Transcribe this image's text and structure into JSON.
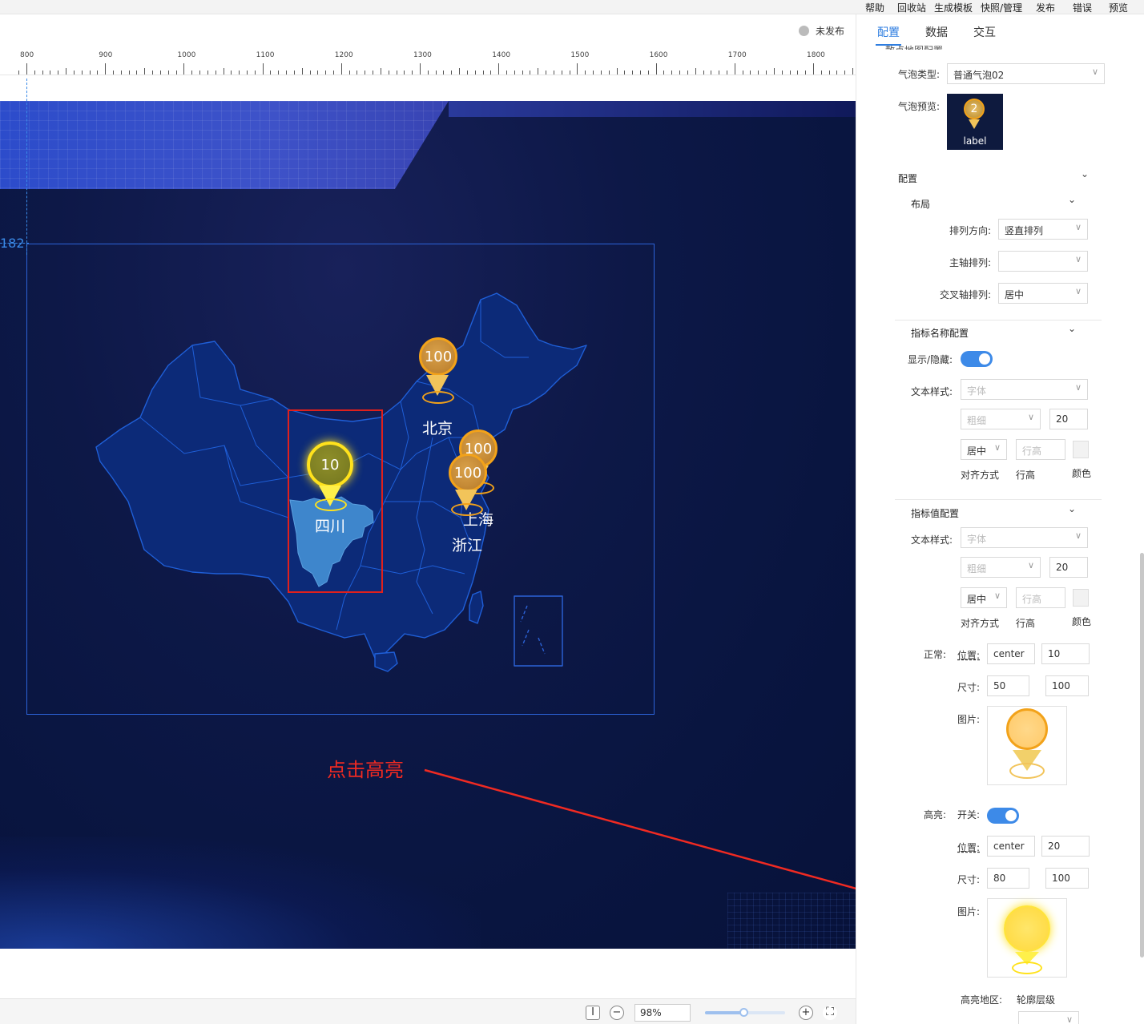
{
  "menu": [
    "帮助",
    "回收站",
    "生成模板",
    "快照/管理",
    "发布",
    "错误",
    "预览"
  ],
  "status": {
    "label": "未发布"
  },
  "ruler": {
    "labels": [
      "800",
      "900",
      "1000",
      "1100",
      "1200",
      "1300",
      "1400",
      "1500",
      "1600",
      "1700",
      "1800"
    ]
  },
  "guide": {
    "value": "182"
  },
  "map": {
    "markers": [
      {
        "value": "100",
        "city": "北京",
        "highlighted": false
      },
      {
        "value": "10",
        "city": "四川",
        "highlighted": true
      },
      {
        "value": "100",
        "city": "上海",
        "highlighted": false
      },
      {
        "value": "100",
        "city": "浙江",
        "highlighted": false
      }
    ],
    "region_fill": "#3e86cc",
    "region_border": "#1f5fd8"
  },
  "annotation": {
    "text": "点击高亮",
    "color": "#f02a22"
  },
  "zoom": {
    "value": "98%",
    "level": 0.48
  },
  "panel": {
    "tabs": [
      "配置",
      "数据",
      "交互"
    ],
    "clipped_header": "散点地图配置",
    "bubble_type": {
      "label": "气泡类型:",
      "value": "普通气泡02"
    },
    "bubble_preview": {
      "label": "气泡预览:",
      "number": "2",
      "caption": "label"
    },
    "config": {
      "title": "配置"
    },
    "layout": {
      "title": "布局",
      "direction": {
        "label": "排列方向:",
        "value": "竖直排列"
      },
      "main_axis": {
        "label": "主轴排列:",
        "value": ""
      },
      "cross_axis": {
        "label": "交叉轴排列:",
        "value": "居中"
      }
    },
    "name_config": {
      "title": "指标名称配置",
      "visible": {
        "label": "显示/隐藏:"
      },
      "text_style": {
        "label": "文本样式:",
        "font_placeholder": "字体",
        "weight_placeholder": "粗细",
        "size": "20",
        "align": "居中",
        "line_height_placeholder": "行高"
      },
      "captions": [
        "对齐方式",
        "行高",
        "颜色"
      ]
    },
    "value_config": {
      "title": "指标值配置",
      "text_style": {
        "label": "文本样式:",
        "font_placeholder": "字体",
        "weight_placeholder": "粗细",
        "size": "20",
        "align": "居中",
        "line_height_placeholder": "行高"
      },
      "captions": [
        "对齐方式",
        "行高",
        "颜色"
      ],
      "normal": {
        "label": "正常:",
        "position_label": "位置:",
        "position": "center",
        "position_offset": "10",
        "size_label": "尺寸:",
        "width": "50",
        "height": "100",
        "image_label": "图片:"
      },
      "highlight": {
        "label": "高亮:",
        "switch_label": "开关:",
        "position_label": "位置:",
        "position": "center",
        "position_offset": "20",
        "size_label": "尺寸:",
        "width": "80",
        "height": "100",
        "image_label": "图片:"
      },
      "highlight_region": {
        "label": "高亮地区:",
        "outline_label": "轮廓层级"
      }
    }
  }
}
